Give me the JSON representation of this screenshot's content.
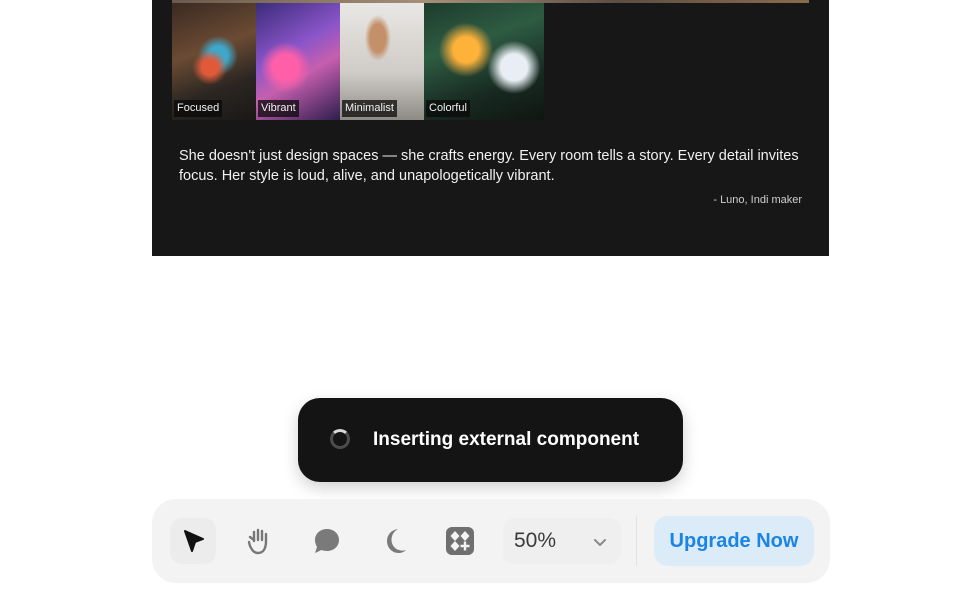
{
  "card": {
    "thumbnails": [
      {
        "label": "Focused"
      },
      {
        "label": "Vibrant"
      },
      {
        "label": "Minimalist"
      },
      {
        "label": "Colorful"
      }
    ],
    "quote": "She doesn't just design spaces — she crafts energy. Every room tells a story. Every detail invites focus. Her style is loud, alive, and unapologetically vibrant.",
    "attribution": "- Luno, Indi maker"
  },
  "toast": {
    "message": "Inserting external component",
    "status_icon": "loading-spinner-icon"
  },
  "toolbar": {
    "tools": [
      {
        "name": "select",
        "icon": "cursor-arrow-icon",
        "active": true
      },
      {
        "name": "hand",
        "icon": "hand-icon",
        "active": false
      },
      {
        "name": "comment",
        "icon": "speech-bubble-icon",
        "active": false
      },
      {
        "name": "theme",
        "icon": "moon-icon",
        "active": false
      },
      {
        "name": "components",
        "icon": "components-grid-icon",
        "active": false
      }
    ],
    "zoom_value": "50%",
    "upgrade_label": "Upgrade Now"
  },
  "colors": {
    "card_background": "#171717",
    "toast_background": "#141414",
    "upgrade_text": "#1b84e7",
    "upgrade_background": "#dcebf8",
    "toolbar_background": "#f3f3f3"
  }
}
